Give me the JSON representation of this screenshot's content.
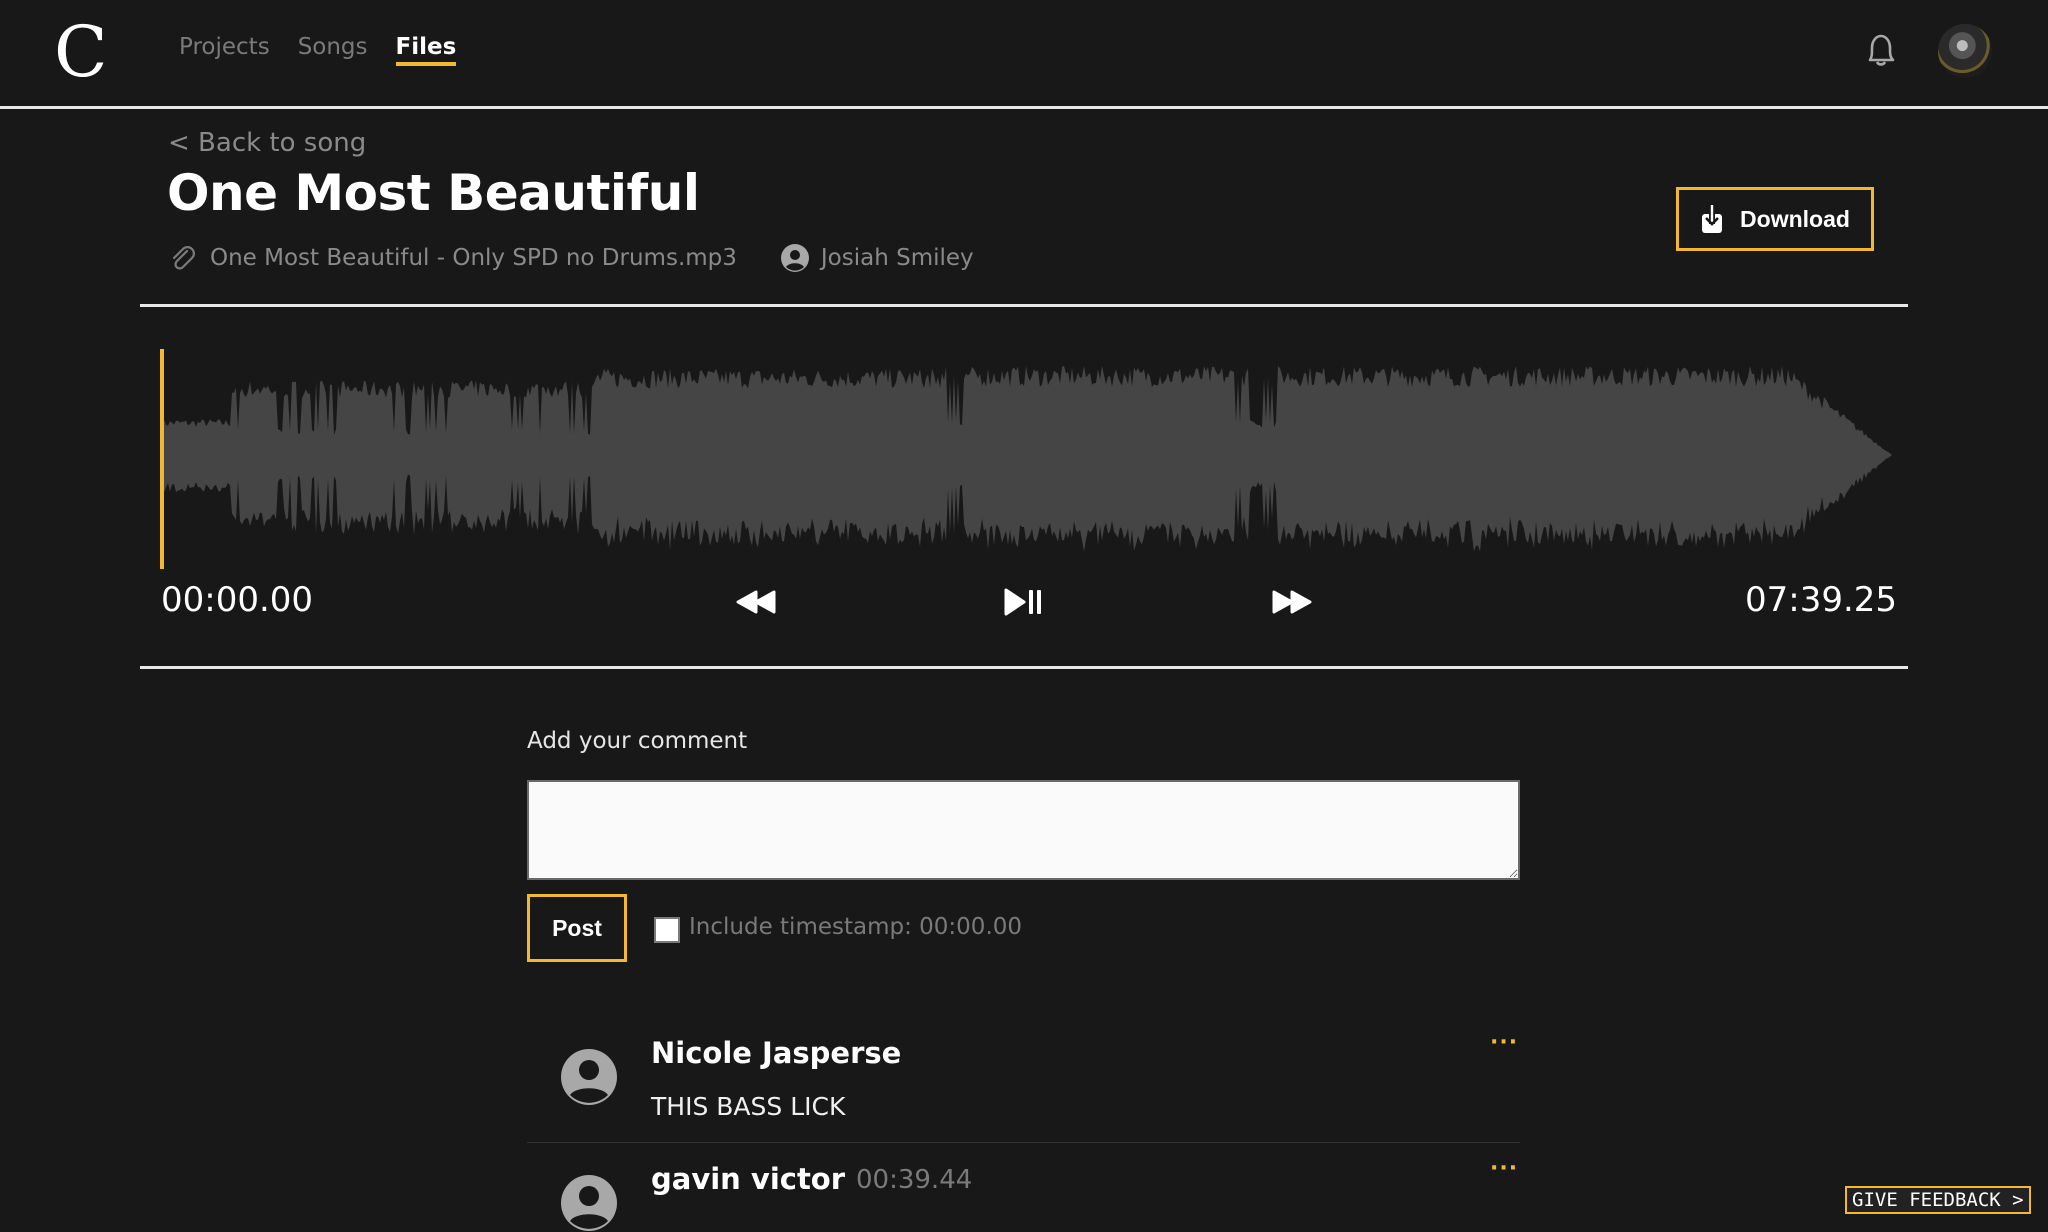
{
  "app": {
    "logo_letter": "C",
    "nav": [
      {
        "label": "Projects",
        "active": false
      },
      {
        "label": "Songs",
        "active": false
      },
      {
        "label": "Files",
        "active": true
      }
    ],
    "icons": {
      "notifications": "bell-icon",
      "profile": "user-avatar"
    }
  },
  "file": {
    "back_label": "< Back to song",
    "title": "One Most Beautiful",
    "filename": "One Most Beautiful - Only SPD no Drums.mp3",
    "owner": "Josiah Smiley",
    "download_label": "Download"
  },
  "player": {
    "current_time": "00:00.00",
    "duration": "07:39.25",
    "progress": 0,
    "controls": [
      "rewind",
      "play-pause",
      "fast-forward"
    ]
  },
  "comment_form": {
    "label": "Add your comment",
    "value": "",
    "placeholder": "",
    "post_label": "Post",
    "include_timestamp_label": "Include timestamp: 00:00.00",
    "include_timestamp_checked": false
  },
  "comments": [
    {
      "author": "Nicole Jasperse",
      "timestamp": "",
      "text": "THIS BASS LICK",
      "more": "···"
    },
    {
      "author": "gavin victor",
      "timestamp": "00:39.44",
      "text": "",
      "more": "···"
    }
  ],
  "feedback_label": "GIVE FEEDBACK >",
  "colors": {
    "accent": "#f4b731",
    "background": "#181818",
    "waveform": "#454545",
    "muted_text": "#7a7a7a"
  }
}
